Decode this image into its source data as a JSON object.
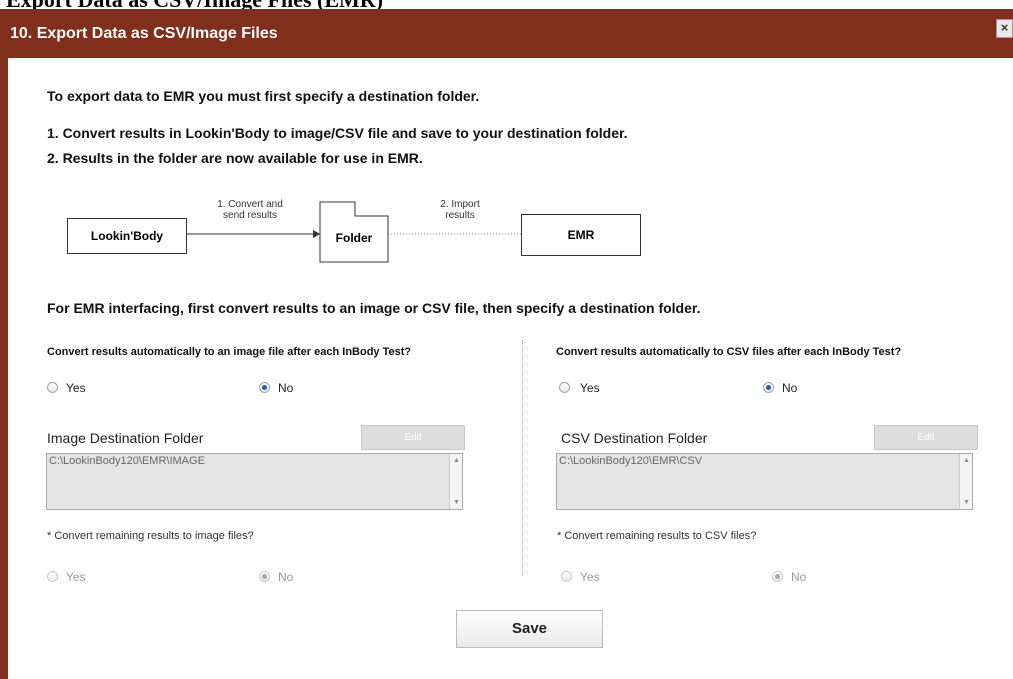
{
  "cut_heading": "Export Data as CSV/Image Files (EMR)",
  "window": {
    "title": "10. Export Data as CSV/Image Files",
    "close_glyph": "×"
  },
  "intro": {
    "line1": "To export data to EMR you must first specify a destination folder.",
    "step1": "1. Convert results in Lookin'Body to image/CSV file and save to your destination folder.",
    "step2": "2. Results in the folder are now available for use in EMR."
  },
  "diagram": {
    "source": "Lookin'Body",
    "folder": "Folder",
    "target": "EMR",
    "arrow1_line1": "1. Convert and",
    "arrow1_line2": "send results",
    "arrow2_line1": "2. Import",
    "arrow2_line2": "results"
  },
  "section_heading": "For EMR interfacing, first convert results to an image or CSV file, then specify a destination folder.",
  "image_panel": {
    "question": "Convert results automatically to an image file after each InBody Test?",
    "yes": "Yes",
    "no": "No",
    "selected": "No",
    "folder_label": "Image Destination Folder",
    "edit_label": "Edit",
    "path": "C:\\LookinBody120\\EMR\\IMAGE",
    "remaining_question": "* Convert remaining results to image files?",
    "remaining_yes": "Yes",
    "remaining_no": "No",
    "remaining_selected": "No"
  },
  "csv_panel": {
    "question": "Convert results automatically to CSV files after each InBody Test?",
    "yes": "Yes",
    "no": "No",
    "selected": "No",
    "folder_label": "CSV Destination Folder",
    "edit_label": "Edit",
    "path": "C:\\LookinBody120\\EMR\\CSV",
    "remaining_question": "* Convert remaining results to CSV files?",
    "remaining_yes": "Yes",
    "remaining_no": "No",
    "remaining_selected": "No"
  },
  "save_label": "Save",
  "colors": {
    "titlebar": "#7f2f1c",
    "selected_radio": "#2a5aa8"
  }
}
